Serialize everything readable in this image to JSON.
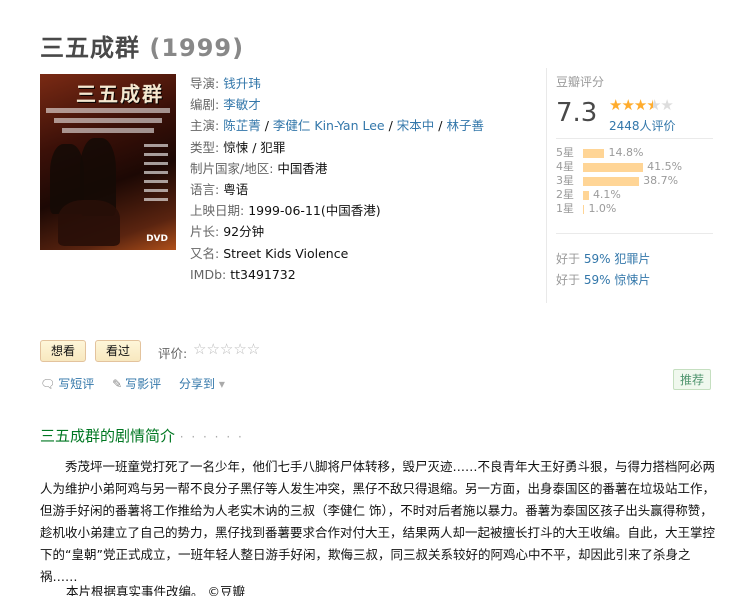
{
  "title": "三五成群",
  "year": "(1999)",
  "poster_title": "三五成群",
  "poster_badge": "DVD",
  "info": {
    "director_label": "导演:",
    "director": "钱升玮",
    "writer_label": "编剧:",
    "writer": "李敏才",
    "cast_label": "主演:",
    "cast": [
      "陈芷菁",
      "李健仁 Kin-Yan Lee",
      "宋本中",
      "林子善"
    ],
    "genre_label": "类型:",
    "genres": [
      "惊悚",
      "犯罪"
    ],
    "country_label": "制片国家/地区:",
    "country": "中国香港",
    "language_label": "语言:",
    "language": "粤语",
    "release_label": "上映日期:",
    "release": "1999-06-11(中国香港)",
    "runtime_label": "片长:",
    "runtime": "92分钟",
    "aka_label": "又名:",
    "aka": "Street Kids Violence",
    "imdb_label": "IMDb:",
    "imdb": "tt3491732"
  },
  "rating": {
    "label": "豆瓣评分",
    "score": "7.3",
    "stars_filled": 3.5,
    "votes": "2448人评价",
    "distribution": [
      {
        "label": "5星",
        "pct": "14.8%",
        "value": 14.8
      },
      {
        "label": "4星",
        "pct": "41.5%",
        "value": 41.5
      },
      {
        "label": "3星",
        "pct": "38.7%",
        "value": 38.7
      },
      {
        "label": "2星",
        "pct": "4.1%",
        "value": 4.1
      },
      {
        "label": "1星",
        "pct": "1.0%",
        "value": 1.0
      }
    ],
    "better_prefix": "好于",
    "better": [
      {
        "pct": "59%",
        "genre": "犯罪片"
      },
      {
        "pct": "59%",
        "genre": "惊悚片"
      }
    ]
  },
  "actions": {
    "want": "想看",
    "watched": "看过",
    "rate_label": "评价:",
    "write_review": "写短评",
    "write_long_review": "写影评",
    "share": "分享到",
    "recommend": "推荐"
  },
  "summary": {
    "title": "三五成群的剧情简介",
    "dots": "· · · · · ·",
    "text": "秀茂坪一班童党打死了一名少年，他们七手八脚将尸体转移，毁尸灭迹……不良青年大王好勇斗狠，与得力搭档阿必两人为维护小弟阿鸡与另一帮不良分子黑仔等人发生冲突，黑仔不敌只得退缩。另一方面，出身泰国区的番薯在垃圾站工作，但游手好闲的番薯将工作推给为人老实木讷的三叔（李健仁 饰），不时对后者施以暴力。番薯为泰国区孩子出头赢得称赞，趁机收小弟建立了自己的势力，黑仔找到番薯要求合作对付大王，结果两人却一起被擅长打斗的大王收编。自此，大王掌控下的“皇朝”党正式成立，一班年轻人整日游手好闲，欺侮三叔，同三叔关系较好的阿鸡心中不平，却因此引来了杀身之祸……",
    "text2": "本片根据真实事件改编。 ©豆瓣"
  }
}
